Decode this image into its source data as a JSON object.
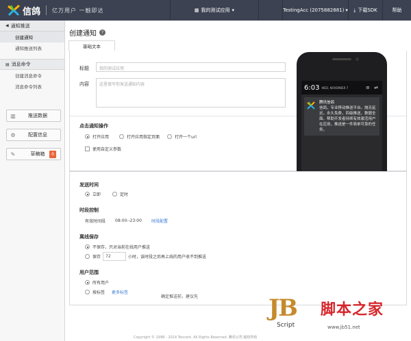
{
  "topbar": {
    "brand": "信鸽",
    "slogan": "亿万用户 一触即达",
    "app_switch": "我的测试应用",
    "account": "TestingAcc (2075882881)",
    "sdk": "下载SDK",
    "help": "帮助"
  },
  "sidebar": {
    "push_section": "通知推送",
    "push_items": [
      "创建通知",
      "通知推送列表"
    ],
    "cmd_section": "消息命令",
    "cmd_items": [
      "创建消息命令",
      "消息命令列表"
    ],
    "buttons": {
      "push_data": "推送数据",
      "config": "配置信息",
      "drafts": "草稿箱",
      "drafts_count": "0"
    }
  },
  "main": {
    "title": "创建通知",
    "tab": "基础文本",
    "title_label": "标题",
    "title_placeholder": "我的测试应用",
    "content_label": "内容",
    "content_placeholder": "这里填写你发送通知内容",
    "click_action_title": "点击通知操作",
    "click_options": [
      "打开应用",
      "打开应用指定页面",
      "打开一个url"
    ],
    "custom_params": "使用自定义参数",
    "send_time_title": "发送时间",
    "send_time_options": [
      "立即",
      "定时"
    ],
    "period_title": "时段控制",
    "period_label": "有效时间段",
    "period_value": "08:00--23:00",
    "period_link": "时段配置",
    "offline_title": "离线保存",
    "offline_opt1": "不保存，只对当前在线用户推送",
    "offline_opt2_prefix": "保存",
    "offline_hours": "72",
    "offline_opt2_suffix": "小时，该时段之后再上线的用户收不到推送",
    "scope_title": "用户范围",
    "scope_options": [
      "所有用户",
      "按标签"
    ],
    "scope_link": "更多标签"
  },
  "phone": {
    "time": "6:03",
    "date": "WED, NOVEMBER 7",
    "notif_title": "腾讯信鸽",
    "notif_body": "信鸽，专业移动推送平台。抛无延迟，永久免费，四级推送，数据全面。帮助开发者持续有效激活用户在应用，推送是一件简单可靠的任务。"
  },
  "footer": {
    "note": "确定推送前，建议先",
    "copyright": "Copyright © 1998 - 2014 Tencent. All Rights Reserved. 腾讯公司 版权所有"
  },
  "watermark": {
    "jb": "JB",
    "script": "Script",
    "cn": "脚本之家",
    "url": "www.jb51.net"
  },
  "colors": {
    "topbar": "#3c4251",
    "accent_link": "#3a7bd5",
    "badge": "#e8643b"
  }
}
